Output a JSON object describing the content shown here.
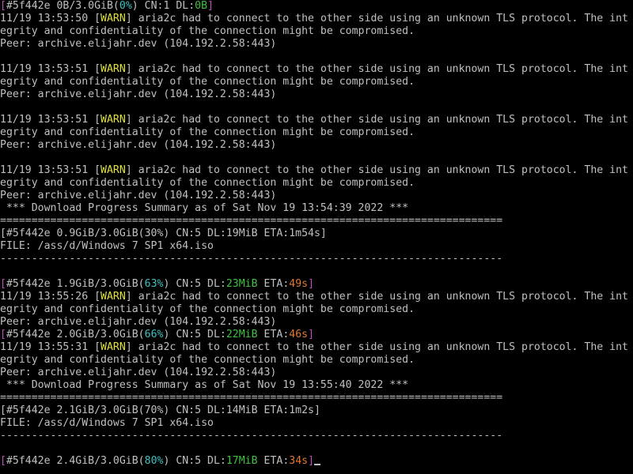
{
  "colors": {
    "default": "#c0c0c0",
    "magenta": "#c050c0",
    "yellow": "#e0e040",
    "green": "#40c040",
    "cyan": "#40c0c0",
    "orange": "#e07830"
  },
  "terminal": {
    "lines": [
      [
        {
          "t": "[",
          "c": "magenta"
        },
        {
          "t": "#5f442e 0B/3.0GiB("
        },
        {
          "t": "0%",
          "c": "cyan"
        },
        {
          "t": ") CN:1 DL:"
        },
        {
          "t": "0B",
          "c": "green"
        },
        {
          "t": "]",
          "c": "magenta"
        }
      ],
      [
        {
          "t": "11/19 13:53:50 ["
        },
        {
          "t": "WARN",
          "c": "yellow"
        },
        {
          "t": "] aria2c had to connect to the other side using an unknown TLS protocol. The int"
        }
      ],
      [
        {
          "t": "egrity and confidentiality of the connection might be compromised."
        }
      ],
      [
        {
          "t": "Peer: archive.elijahr.dev (104.192.2.58:443)"
        }
      ],
      [],
      [
        {
          "t": "11/19 13:53:51 ["
        },
        {
          "t": "WARN",
          "c": "yellow"
        },
        {
          "t": "] aria2c had to connect to the other side using an unknown TLS protocol. The int"
        }
      ],
      [
        {
          "t": "egrity and confidentiality of the connection might be compromised."
        }
      ],
      [
        {
          "t": "Peer: archive.elijahr.dev (104.192.2.58:443)"
        }
      ],
      [],
      [
        {
          "t": "11/19 13:53:51 ["
        },
        {
          "t": "WARN",
          "c": "yellow"
        },
        {
          "t": "] aria2c had to connect to the other side using an unknown TLS protocol. The int"
        }
      ],
      [
        {
          "t": "egrity and confidentiality of the connection might be compromised."
        }
      ],
      [
        {
          "t": "Peer: archive.elijahr.dev (104.192.2.58:443)"
        }
      ],
      [],
      [
        {
          "t": "11/19 13:53:51 ["
        },
        {
          "t": "WARN",
          "c": "yellow"
        },
        {
          "t": "] aria2c had to connect to the other side using an unknown TLS protocol. The int"
        }
      ],
      [
        {
          "t": "egrity and confidentiality of the connection might be compromised."
        }
      ],
      [
        {
          "t": "Peer: archive.elijahr.dev (104.192.2.58:443)"
        }
      ],
      [
        {
          "t": " *** Download Progress Summary as of Sat Nov 19 13:54:39 2022 ***"
        }
      ],
      [
        {
          "t": "================================================================================"
        }
      ],
      [
        {
          "t": "[#5f442e 0.9GiB/3.0GiB(30%) CN:5 DL:19MiB ETA:1m54s]"
        }
      ],
      [
        {
          "t": "FILE: /ass/d/Windows 7 SP1 x64.iso"
        }
      ],
      [
        {
          "t": "--------------------------------------------------------------------------------"
        }
      ],
      [],
      [
        {
          "t": "[",
          "c": "magenta"
        },
        {
          "t": "#5f442e 1.9GiB/3.0GiB("
        },
        {
          "t": "63%",
          "c": "cyan"
        },
        {
          "t": ") CN:5 DL:"
        },
        {
          "t": "23MiB",
          "c": "green"
        },
        {
          "t": " ETA:"
        },
        {
          "t": "49s",
          "c": "orange"
        },
        {
          "t": "]",
          "c": "magenta"
        }
      ],
      [
        {
          "t": "11/19 13:55:26 ["
        },
        {
          "t": "WARN",
          "c": "yellow"
        },
        {
          "t": "] aria2c had to connect to the other side using an unknown TLS protocol. The int"
        }
      ],
      [
        {
          "t": "egrity and confidentiality of the connection might be compromised."
        }
      ],
      [
        {
          "t": "Peer: archive.elijahr.dev (104.192.2.58:443)"
        }
      ],
      [
        {
          "t": "[",
          "c": "magenta"
        },
        {
          "t": "#5f442e 2.0GiB/3.0GiB("
        },
        {
          "t": "66%",
          "c": "cyan"
        },
        {
          "t": ") CN:5 DL:"
        },
        {
          "t": "22MiB",
          "c": "green"
        },
        {
          "t": " ETA:"
        },
        {
          "t": "46s",
          "c": "orange"
        },
        {
          "t": "]",
          "c": "magenta"
        }
      ],
      [
        {
          "t": "11/19 13:55:31 ["
        },
        {
          "t": "WARN",
          "c": "yellow"
        },
        {
          "t": "] aria2c had to connect to the other side using an unknown TLS protocol. The int"
        }
      ],
      [
        {
          "t": "egrity and confidentiality of the connection might be compromised."
        }
      ],
      [
        {
          "t": "Peer: archive.elijahr.dev (104.192.2.58:443)"
        }
      ],
      [
        {
          "t": " *** Download Progress Summary as of Sat Nov 19 13:55:40 2022 ***"
        }
      ],
      [
        {
          "t": "================================================================================"
        }
      ],
      [
        {
          "t": "[#5f442e 2.1GiB/3.0GiB(70%) CN:5 DL:14MiB ETA:1m2s]"
        }
      ],
      [
        {
          "t": "FILE: /ass/d/Windows 7 SP1 x64.iso"
        }
      ],
      [
        {
          "t": "--------------------------------------------------------------------------------"
        }
      ],
      [],
      [
        {
          "t": "[",
          "c": "magenta"
        },
        {
          "t": "#5f442e 2.4GiB/3.0GiB("
        },
        {
          "t": "80%",
          "c": "cyan"
        },
        {
          "t": ") CN:5 DL:"
        },
        {
          "t": "17MiB",
          "c": "green"
        },
        {
          "t": " ETA:"
        },
        {
          "t": "34s",
          "c": "orange"
        },
        {
          "t": "]",
          "c": "magenta"
        }
      ]
    ]
  }
}
